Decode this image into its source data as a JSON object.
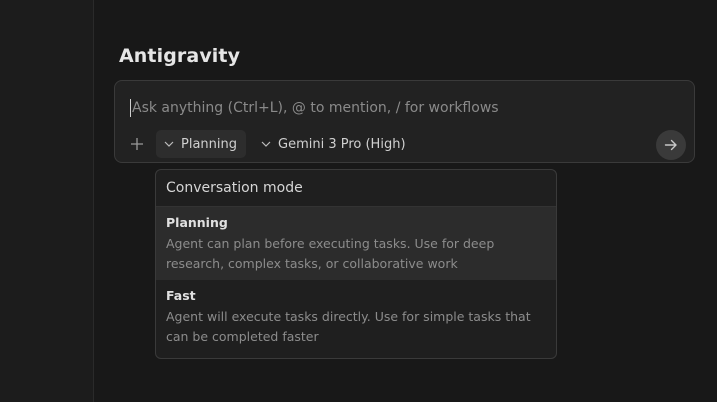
{
  "page": {
    "title": "Antigravity"
  },
  "composer": {
    "placeholder": "Ask anything (Ctrl+L), @ to mention, / for workflows",
    "value": "",
    "mode_label": "Planning",
    "model_label": "Gemini 3 Pro (High)"
  },
  "icons": {
    "add": "plus-icon",
    "mode_chevron": "chevron-down-icon",
    "model_chevron": "chevron-down-icon",
    "send": "arrow-right-icon"
  },
  "dropdown": {
    "header": "Conversation mode",
    "options": [
      {
        "title": "Planning",
        "description": "Agent can plan before executing tasks. Use for deep research, complex tasks, or collaborative work",
        "selected": true
      },
      {
        "title": "Fast",
        "description": "Agent will execute tasks directly. Use for simple tasks that can be completed faster",
        "selected": false
      }
    ]
  },
  "colors": {
    "background": "#181818",
    "surface": "#222222",
    "border": "#3a3a3a",
    "text": "#cccccc",
    "muted": "#8c8c8c"
  }
}
